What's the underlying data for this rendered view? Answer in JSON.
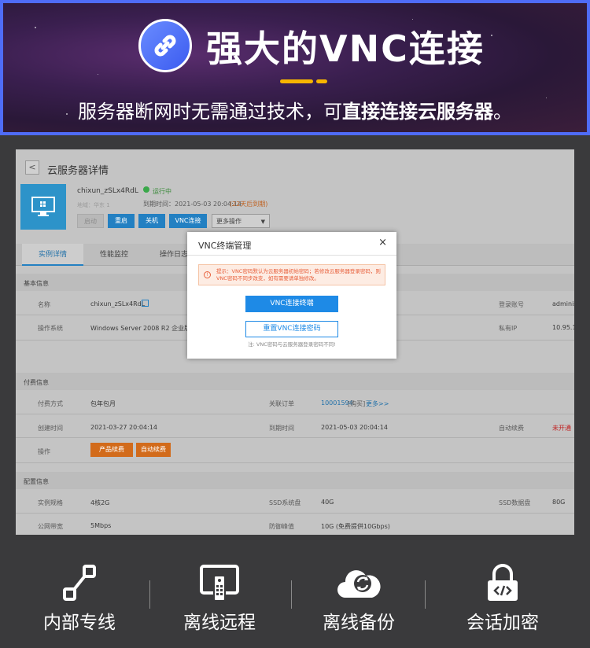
{
  "banner": {
    "title": "强大的VNC连接",
    "subtitle_prefix": "服务器断网时无需通过技术，可",
    "subtitle_bold": "直接连接云服务器",
    "subtitle_suffix": "。",
    "border_color": "#4f6cf7",
    "accent_color": "#f7b500"
  },
  "console": {
    "page_title": "云服务器详情",
    "back_label": "<",
    "instance_name": "chixun_zSLx4RdL",
    "status": "运行中",
    "sub_info": "地域：华东 1",
    "expire_label": "到期时间：2021-05-03 20:04:14",
    "expire_note": "(22天后到期)",
    "buttons": {
      "start": "启动",
      "restart": "重启",
      "shutdown": "关机",
      "vnc": "VNC连接",
      "more": "更多操作"
    },
    "tabs": [
      "实例详情",
      "性能监控",
      "操作日志"
    ],
    "basic_section": "基本信息",
    "basic": {
      "name_label": "名称",
      "name_value": "chixun_zSLx4RdL",
      "os_label": "操作系统",
      "os_value": "Windows Server 2008 R2 企业版",
      "login_label": "登录账号",
      "login_value": "administ",
      "ip_label": "私有IP",
      "ip_value": "10.95.16"
    },
    "billing_section": "付费信息",
    "billing": {
      "pay_label": "付费方式",
      "pay_value": "包年包月",
      "order_label": "关联订单",
      "order_value": "10001594",
      "order_tag": "[购买]",
      "order_more": "更多>>",
      "created_label": "创建时间",
      "created_value": "2021-03-27 20:04:14",
      "expire_label": "到期时间",
      "expire_value": "2021-05-03 20:04:14",
      "auto_label": "自动续费",
      "auto_value": "未开通",
      "op_label": "操作",
      "renew_btn": "产品续费",
      "auto_btn": "自动续费"
    },
    "config_section": "配置信息",
    "config": {
      "spec_label": "实例规格",
      "spec_value": "4核2G",
      "ssd_sys_label": "SSD系统盘",
      "ssd_sys_value": "40G",
      "ssd_data_label": "SSD数据盘",
      "ssd_data_value": "80G",
      "bw_label": "公网带宽",
      "bw_value": "5Mbps",
      "def_label": "防御峰值",
      "def_value": "10G (免费提供10Gbps)"
    }
  },
  "dialog": {
    "title": "VNC终端管理",
    "close": "×",
    "tip": "提示：VNC密码默认为云服务器初始密码；若修改云服务器登录密码，则VNC密码不同步改变，如有需要请单独修改。",
    "connect_btn": "VNC连接终端",
    "reset_btn": "重置VNC连接密码",
    "note": "注: VNC密码与云服务器登录密码不同!"
  },
  "features": [
    {
      "label": "内部专线",
      "icon": "line-icon"
    },
    {
      "label": "离线远程",
      "icon": "remote-icon"
    },
    {
      "label": "离线备份",
      "icon": "cloud-sync-icon"
    },
    {
      "label": "会话加密",
      "icon": "lock-code-icon"
    }
  ]
}
